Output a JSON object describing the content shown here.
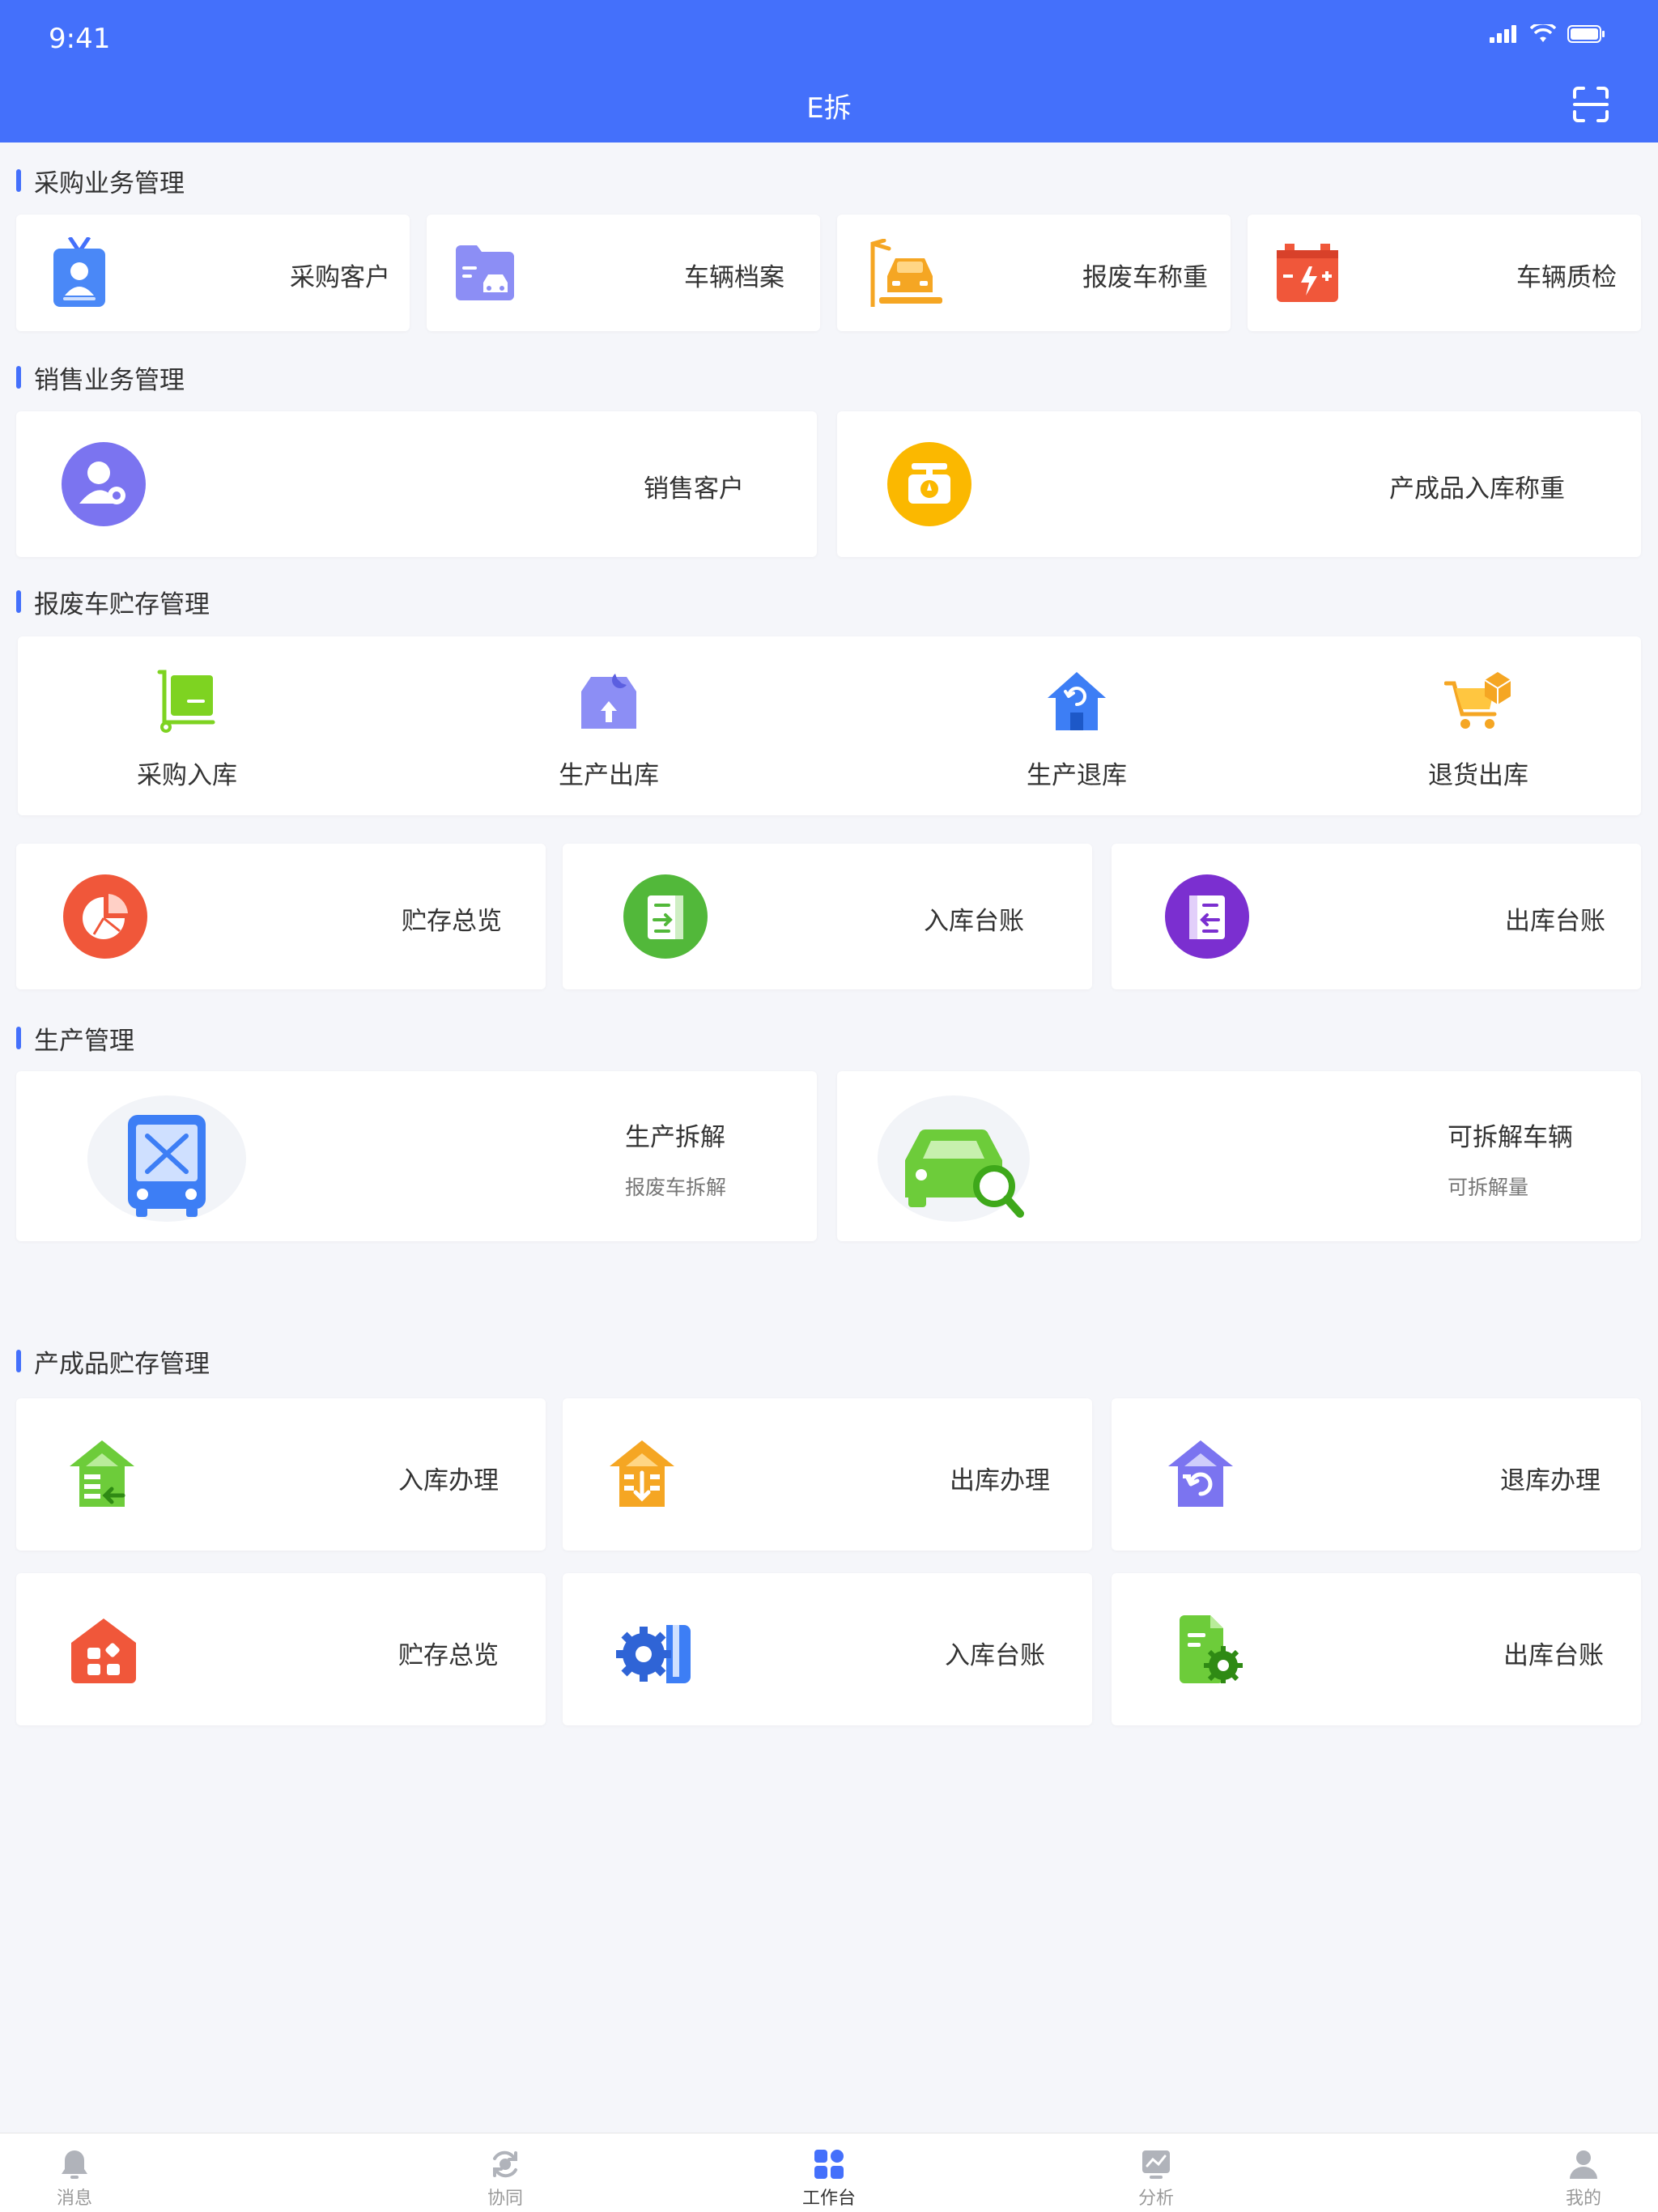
{
  "status_bar": {
    "time": "9:41"
  },
  "nav": {
    "title": "E拆"
  },
  "sections": {
    "purchase": {
      "title": "采购业务管理",
      "items": [
        "采购客户",
        "车辆档案",
        "报废车称重",
        "车辆质检"
      ]
    },
    "sales": {
      "title": "销售业务管理",
      "items": [
        "销售客户",
        "产成品入库称重"
      ]
    },
    "scrap_storage": {
      "title": "报废车贮存管理",
      "tiles": [
        "采购入库",
        "生产出库",
        "生产退库",
        "退货出库"
      ],
      "items": [
        "贮存总览",
        "入库台账",
        "出库台账"
      ]
    },
    "production": {
      "title": "生产管理",
      "cards": [
        {
          "label": "生产拆解",
          "sub": "报废车拆解"
        },
        {
          "label": "可拆解车辆",
          "sub": "可拆解量"
        }
      ]
    },
    "product_storage": {
      "title": "产成品贮存管理",
      "items": [
        "入库办理",
        "出库办理",
        "退库办理",
        "贮存总览",
        "入库台账",
        "出库台账"
      ]
    }
  },
  "tabbar": {
    "items": [
      {
        "label": "消息",
        "icon": "bell-icon"
      },
      {
        "label": "协同",
        "icon": "sync-icon"
      },
      {
        "label": "工作台",
        "icon": "grid-icon",
        "active": true
      },
      {
        "label": "分析",
        "icon": "chart-icon"
      },
      {
        "label": "我的",
        "icon": "user-icon"
      }
    ]
  },
  "colors": {
    "primary": "#4470fb",
    "background": "#f5f6fa"
  }
}
